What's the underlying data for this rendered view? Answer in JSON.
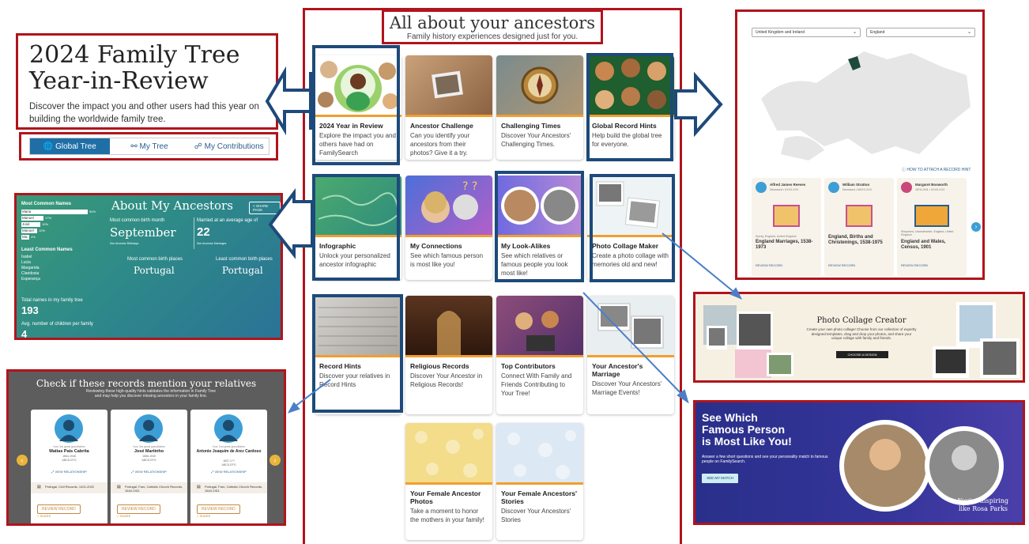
{
  "center": {
    "title": "All about your ancestors",
    "subtitle": "Family history experiences designed just for you.",
    "cards": [
      {
        "title": "2024 Year in Review",
        "desc": "Explore the impact you and others have had on FamilySearch"
      },
      {
        "title": "Ancestor Challenge",
        "desc": "Can you identify your ancestors from their photos? Give it a try."
      },
      {
        "title": "Challenging Times",
        "desc": "Discover Your Ancestors' Challenging Times."
      },
      {
        "title": "Global Record Hints",
        "desc": "Help build the global tree for everyone."
      },
      {
        "title": "Infographic",
        "desc": "Unlock your personalized ancestor infographic"
      },
      {
        "title": "My Connections",
        "desc": "See which famous person is most like you!"
      },
      {
        "title": "My Look-Alikes",
        "desc": "See which relatives or famous people you look most like!"
      },
      {
        "title": "Photo Collage Maker",
        "desc": "Create a photo collage with memories old and new!"
      },
      {
        "title": "Record Hints",
        "desc": "Discover your relatives in Record Hints"
      },
      {
        "title": "Religious Records",
        "desc": "Discover Your Ancestor in Religious Records!"
      },
      {
        "title": "Top Contributors",
        "desc": "Connect With Family and Friends Contributing to Your Tree!"
      },
      {
        "title": "Your Ancestor's Marriage",
        "desc": "Discover Your Ancestors' Marriage Events!"
      },
      {
        "title": "Your Female Ancestor Photos",
        "desc": "Take a moment to honor the mothers in your family!"
      },
      {
        "title": "Your Female Ancestors' Stories",
        "desc": "Discover Your Ancestors' Stories"
      }
    ]
  },
  "year_review": {
    "title_line1": "2024 Family Tree",
    "title_line2": "Year-in-Review",
    "desc": "Discover the impact you and other users had this year on building the worldwide family tree.",
    "tabs": [
      "Global Tree",
      "My Tree",
      "My Contributions"
    ]
  },
  "about_ancestors": {
    "title": "About My Ancestors",
    "share": "SHARE PAGE",
    "most_common_label": "Most Common Names",
    "most_common": [
      {
        "name": "Maria",
        "pct": "94%"
      },
      {
        "name": "Manuel",
        "pct": "17%"
      },
      {
        "name": "José",
        "pct": "10%"
      },
      {
        "name": "Manoel",
        "pct": "10%"
      },
      {
        "name": "Ma...",
        "pct": "4%"
      }
    ],
    "least_common_label": "Least Common Names",
    "least_common": [
      "Isabel",
      "Lucia",
      "Margarida",
      "Claridosia",
      "Esperança"
    ],
    "birth_month_label": "Most common birth month",
    "birth_month": "September",
    "birth_month_link": "See Ancestor Birthdays",
    "marriage_age_label": "Married at an average age of",
    "marriage_age": "22",
    "marriage_link": "See Ancestor Marriages",
    "birthplace_label": "Most common birth places",
    "birthplace": "Portugal",
    "birthplace2_label": "Least common birth places",
    "birthplace2": "Portugal",
    "total_label": "Total names in my family tree",
    "total": "193",
    "avg_label": "Avg. number of children per family",
    "avg": "4"
  },
  "record_hints": {
    "title": "Check if these records mention your relatives",
    "subtitle": "Reviewing these high-quality hints validates the information in Family Tree and may help you discover missing ancestors in your family line.",
    "people": [
      {
        "relation": "Your 3rd great grandfather",
        "name": "Matias Pais Cabrita",
        "dates": "1864-1948",
        "id": "ABCD-EFG",
        "rel_link": "VIEW RELATIONSHIP",
        "source": "Portugal, Civil Records, 1421-2022",
        "btn": "REVIEW RECORD",
        "share": "SHARE"
      },
      {
        "relation": "Your 3rd great grandfather",
        "name": "José Martinho",
        "dates": "1856-1930",
        "id": "ABCD-EFG",
        "rel_link": "VIEW RELATIONSHIP",
        "source": "Portugal, Faro, Catholic Church Records, 1544-1911",
        "btn": "REVIEW RECORD",
        "share": "SHARE"
      },
      {
        "relation": "Your 2nd great grandfather",
        "name": "Antonio Joaquim de Arez Cardoso",
        "dates": "1807-1??",
        "id": "ABCD-EFG",
        "rel_link": "VIEW RELATIONSHIP",
        "source": "Portugal, Faro, Catholic Church Records, 1544-1911",
        "btn": "REVIEW RECORD",
        "share": "SHARE"
      }
    ]
  },
  "map_panel": {
    "select1": "United Kingdom and Ireland",
    "select2": "England",
    "help_link": "HOW TO ATTACH A RECORD HINT",
    "records": [
      {
        "name": "Alfred James Reeves",
        "life": "Deceased • XXXX-XXX",
        "place": "Surrey, England, United Kingdom",
        "title": "England Marriages, 1538-1973",
        "btn": "REVIEW RECORD"
      },
      {
        "name": "William Stratton",
        "life": "Deceased • MXXX-XXX",
        "place": "",
        "title": "England, Births and Christenings, 1538-1975",
        "btn": "REVIEW RECORD"
      },
      {
        "name": "Margaret Bosworth",
        "life": "1876-1941 • XXXX-XXX",
        "place": "Shepshed, Leicestershire, England, United Kingdom",
        "title": "England and Wales, Census, 1901",
        "btn": "REVIEW RECORD"
      }
    ]
  },
  "collage_panel": {
    "title": "Photo Collage Creator",
    "desc": "Create your own photo collage! Choose from our collection of expertly designed templates, drag and drop your photos, and share your unique collage with family and friends.",
    "btn": "CHOOSE A DESIGN"
  },
  "famous_panel": {
    "title_line1": "See Which",
    "title_line2": "Famous Person",
    "title_line3": "is Most Like You!",
    "desc": "Answer a few short questions and see your personality match to famous people on FamilySearch.",
    "btn": "SEE MY MATCH",
    "caption_line1": "You're inspiring",
    "caption_line2": "like Rosa Parks"
  },
  "colors": {
    "red": "#b0141c",
    "blue": "#1d4a7a",
    "accent": "#f29e2e",
    "link": "#2b5e8c"
  }
}
